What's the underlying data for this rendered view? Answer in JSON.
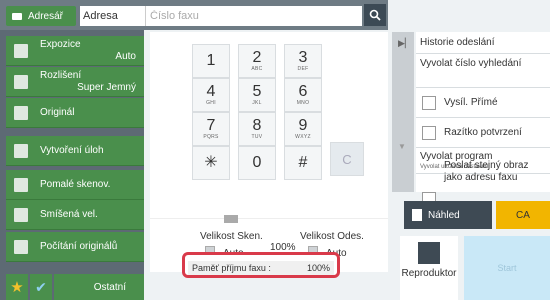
{
  "header": {
    "adresar_label": "Adresář",
    "adresa_label": "Adresa",
    "fax_placeholder": "Číslo faxu"
  },
  "left_menu": [
    {
      "label": "Expozice",
      "value": "Auto"
    },
    {
      "label": "Rozlišení",
      "value": "Super Jemný"
    },
    {
      "label": "Originál",
      "value": ""
    },
    {
      "label": "Vytvoření úloh",
      "value": ""
    },
    {
      "label": "Pomalé skenov.",
      "value": ""
    },
    {
      "label": "Smíšená vel.",
      "value": ""
    },
    {
      "label": "Počítání originálů",
      "value": ""
    }
  ],
  "bottom": {
    "ostatni_label": "Ostatní"
  },
  "keypad": {
    "keys": [
      {
        "digit": "1",
        "sub": ""
      },
      {
        "digit": "2",
        "sub": "ABC"
      },
      {
        "digit": "3",
        "sub": "DEF"
      },
      {
        "digit": "4",
        "sub": "GHI"
      },
      {
        "digit": "5",
        "sub": "JKL"
      },
      {
        "digit": "6",
        "sub": "MNO"
      },
      {
        "digit": "7",
        "sub": "PQRS"
      },
      {
        "digit": "8",
        "sub": "TUV"
      },
      {
        "digit": "9",
        "sub": "WXYZ"
      },
      {
        "digit": "✳",
        "sub": ""
      },
      {
        "digit": "0",
        "sub": ""
      },
      {
        "digit": "#",
        "sub": ""
      }
    ],
    "clear_label": "C"
  },
  "scan": {
    "size_scan_label": "Velikost Sken.",
    "size_send_label": "Velikost Odes.",
    "ratio": "100%",
    "auto1": "Auto",
    "auto2": "Auto"
  },
  "memory": {
    "label": "Paměť příjmu faxu :",
    "value": "100%"
  },
  "right_menu": {
    "historie": "Historie odeslání",
    "vyvolat_cislo": "Vyvolat číslo vyhledání",
    "vysil_prime": "Vysíl. Přímé",
    "razitko": "Razítko potvrzení",
    "vyvolat_program": "Vyvolat program",
    "vyvolat_program_sub": "Vyvolat uložená nastavení",
    "poslat_stejny": "Poslat stejný obraz jako adresu faxu"
  },
  "actions": {
    "nahled": "Náhled",
    "ca": "CA",
    "reproduktor": "Reproduktor",
    "start": "Start"
  }
}
